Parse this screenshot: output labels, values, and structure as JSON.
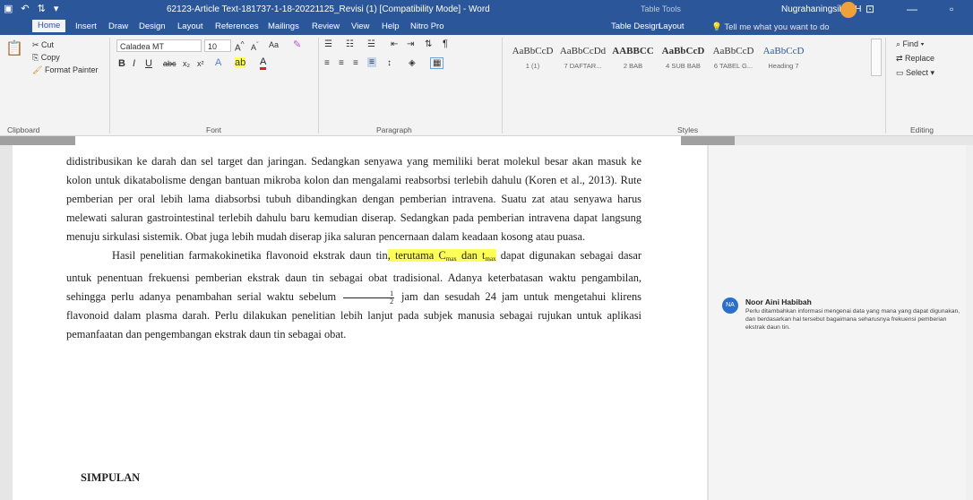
{
  "window": {
    "doc_title": "62123-Article Text-181737-1-18-20221125_Revisi (1) [Compatibility Mode]  -  Word",
    "context_title": "Table Tools",
    "user_name": "Nugrahaningsih WH",
    "qat": [
      "↶",
      "⇅",
      "▾"
    ]
  },
  "ribbon_tabs": [
    "Home",
    "Insert",
    "Draw",
    "Design",
    "Layout",
    "References",
    "Mailings",
    "Review",
    "View",
    "Help",
    "Nitro Pro",
    "Table Design",
    "Layout"
  ],
  "tell_me": "Tell me what you want to do",
  "clipboard": {
    "cut": "Cut",
    "copy": "Copy",
    "format_painter": "Format Painter",
    "label": "Clipboard"
  },
  "font": {
    "name": "Caladea MT",
    "size": "10",
    "label": "Font",
    "change_case": "Aa"
  },
  "paragraph": {
    "label": "Paragraph"
  },
  "styles": {
    "label": "Styles",
    "tiles": [
      {
        "sample": "AaBbCcD",
        "name": "1 (1)"
      },
      {
        "sample": "AaBbCcDd",
        "name": "7 DAFTAR..."
      },
      {
        "sample": "AABBCC",
        "name": "2 BAB"
      },
      {
        "sample": "AaBbCcD",
        "name": "4 SUB BAB"
      },
      {
        "sample": "AaBbCcD",
        "name": "6 TABEL G..."
      },
      {
        "sample": "AaBbCcD",
        "name": "Heading 7"
      }
    ]
  },
  "editing": {
    "find": "Find",
    "replace": "Replace",
    "select": "Select",
    "label": "Editing"
  },
  "document": {
    "para1": "didistribusikan ke darah dan sel target dan jaringan. Sedangkan senyawa yang memiliki berat molekul besar akan masuk ke kolon untuk dikatabolisme dengan bantuan mikroba kolon dan mengalami reabsorbsi terlebih dahulu (Koren et al., 2013). Rute pemberian per oral lebih lama diabsorbsi tubuh dibandingkan dengan pemberian intravena. Suatu zat atau senyawa harus melewati saluran gastrointestinal terlebih dahulu baru kemudian diserap. Sedangkan pada pemberian intravena dapat langsung menuju sirkulasi sistemik. Obat juga lebih mudah diserap jika saluran pencernaan dalam keadaan kosong atau puasa.",
    "para2_start": "Hasil penelitian farmakokinetika flavonoid ekstrak daun tin",
    "para2_hl_a": ", terutama C",
    "para2_hl_sub1": "max",
    "para2_hl_b": " dan t",
    "para2_hl_sub2": "max",
    "para2_rest1": " dapat digunakan sebagai dasar untuk penentuan frekuensi pemberian ekstrak daun tin sebagai obat tradisional. Adanya keterbatasan waktu pengambilan, sehingga perlu adanya penambahan serial waktu sebelum ",
    "frac_num": "1",
    "frac_den": "2",
    "para2_rest2": " jam dan sesudah 24 jam untuk mengetahui klirens flavonoid dalam plasma darah. Perlu dilakukan penelitian lebih lanjut pada subjek manusia sebagai rujukan untuk aplikasi pemanfaatan dan pengembangan ekstrak daun tin sebagai obat.",
    "heading": "SIMPULAN"
  },
  "comment": {
    "initials": "NA",
    "author": "Noor Aini Habibah",
    "text": "Perlu ditambahkan informasi mengenai data yang mana yang dapat digunakan, dan berdasarkan hal tersebut bagaimana seharusnya frekuensi pemberian ekstrak daun tin."
  },
  "colors": {
    "title_bar": "#2b579a",
    "highlight": "#ffff5a",
    "ribbon_bg": "#f3f3f3"
  }
}
